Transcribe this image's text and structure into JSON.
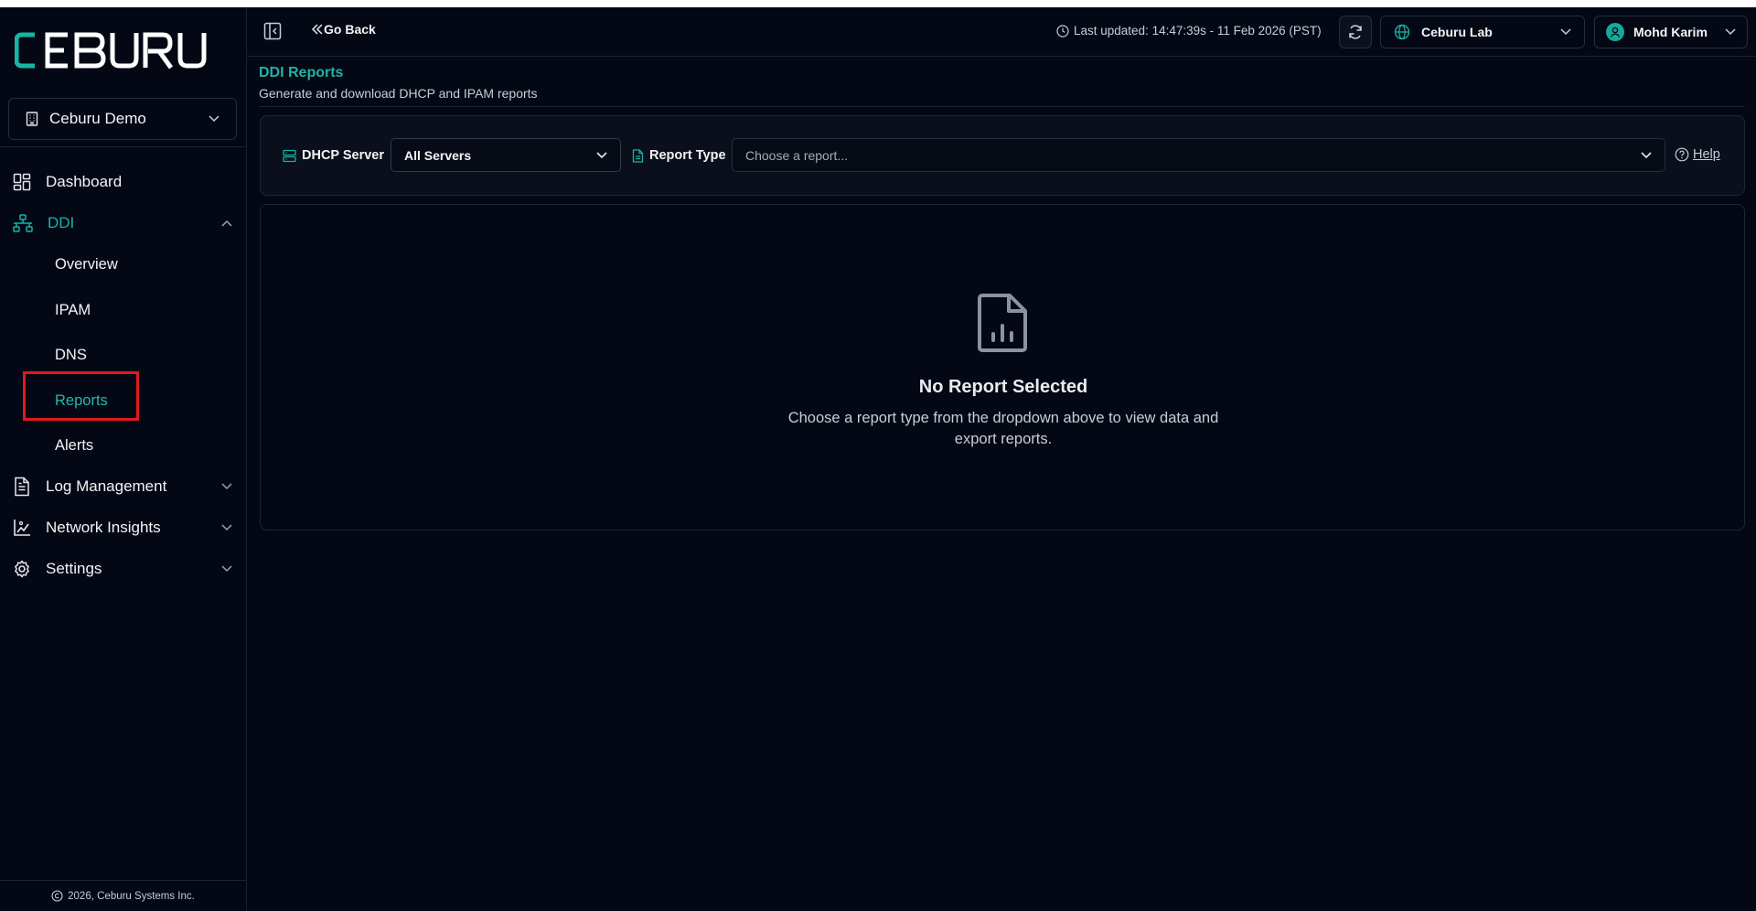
{
  "sidebar": {
    "logo_text": "CEBURU",
    "org_select": "Ceburu Demo",
    "nav": {
      "dashboard": "Dashboard",
      "ddi": "DDI",
      "ddi_children": {
        "overview": "Overview",
        "ipam": "IPAM",
        "dns": "DNS",
        "reports": "Reports",
        "alerts": "Alerts"
      },
      "log_management": "Log Management",
      "network_insights": "Network Insights",
      "settings": "Settings"
    },
    "footer": "2026, Ceburu Systems Inc."
  },
  "topbar": {
    "go_back": "Go Back",
    "last_updated": "Last updated: 14:47:39s - 11 Feb 2026 (PST)",
    "site_select": "Ceburu Lab",
    "user_name": "Mohd Karim"
  },
  "page": {
    "title": "DDI Reports",
    "subtitle": "Generate and download DHCP and IPAM reports"
  },
  "filters": {
    "dhcp_server_label": "DHCP Server",
    "dhcp_server_value": "All Servers",
    "report_type_label": "Report Type",
    "report_type_placeholder": "Choose a report...",
    "help": "Help"
  },
  "empty_state": {
    "title": "No Report Selected",
    "description": "Choose a report type from the dropdown above to view data and export reports."
  },
  "colors": {
    "accent": "#1fb3a8",
    "background": "#040814",
    "highlight": "#e0191f"
  }
}
